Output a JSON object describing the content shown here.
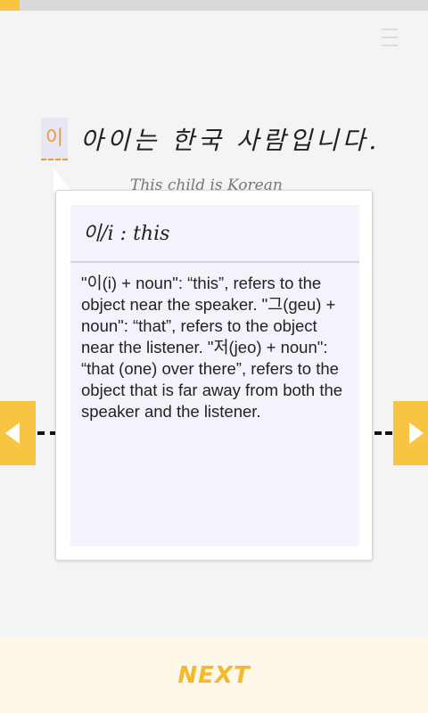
{
  "progress": {
    "value_fraction": 0.045,
    "color": "#f7c542"
  },
  "sentence": {
    "highlighted_word": "이",
    "rest": "아이는 한국 사람입니다.",
    "translation": "This child is Korean"
  },
  "popup": {
    "title": "이/i : this",
    "body": "\"이(i) + noun\": “this”, refers to the object near the speaker. \"그(geu) + noun\": “that”, refers to the object near the listener. \"저(jeo) + noun\": “that (one) over there”, refers to the object that is far away from both the speaker and the listener."
  },
  "footer": {
    "next_label": "NEXT"
  },
  "colors": {
    "accent": "#f7c542",
    "highlight_text": "#f2963a",
    "next_text": "#f4b92c"
  },
  "icons": {
    "menu": "menu-icon",
    "prev": "chevron-left-icon",
    "next": "chevron-right-icon"
  }
}
